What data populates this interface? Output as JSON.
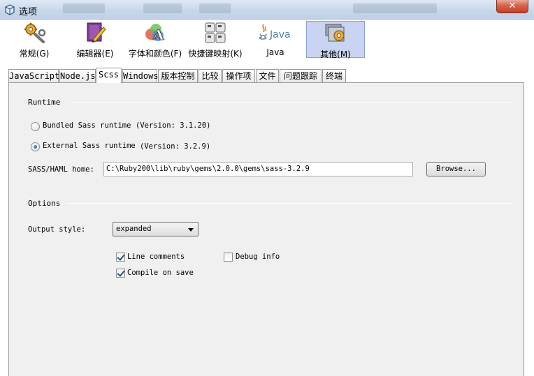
{
  "window": {
    "title": "选项",
    "close_label": "✕"
  },
  "categories": [
    {
      "label": "常规(G)",
      "icon": "gears-icon"
    },
    {
      "label": "编辑器(E)",
      "icon": "editor-book-icon"
    },
    {
      "label": "字体和颜色(F)",
      "icon": "font-colors-icon"
    },
    {
      "label": "快捷键映射(K)",
      "icon": "keyboard-icon"
    },
    {
      "label": "Java",
      "icon": "java-icon"
    },
    {
      "label": "其他(M)",
      "icon": "misc-icon",
      "selected": true
    }
  ],
  "tabs": [
    "JavaScript",
    "Node.js",
    "Scss",
    "Windows",
    "版本控制",
    "比较",
    "操作项",
    "文件",
    "问题跟踪",
    "终端"
  ],
  "active_tab": "Scss",
  "runtime": {
    "section_label": "Runtime",
    "bundled": {
      "label": "Bundled Sass runtime",
      "version": "(Version: 3.1.20)",
      "checked": false
    },
    "external": {
      "label": "External Sass runtime",
      "version": "(Version: 3.2.9)",
      "checked": true
    },
    "home_label": "SASS/HAML home:",
    "home_value": "C:\\Ruby200\\lib\\ruby\\gems\\2.0.0\\gems\\sass-3.2.9",
    "browse_label": "Browse..."
  },
  "options": {
    "section_label": "Options",
    "output_style_label": "Output style:",
    "output_style_value": "expanded",
    "line_comments": {
      "label": "Line comments",
      "checked": true
    },
    "debug_info": {
      "label": "Debug info",
      "checked": false
    },
    "compile_on_save": {
      "label": "Compile on save",
      "checked": true
    }
  },
  "colors": {
    "selected_category_bg": "#c9d4f2",
    "panel_bg": "#f0f0f0"
  }
}
